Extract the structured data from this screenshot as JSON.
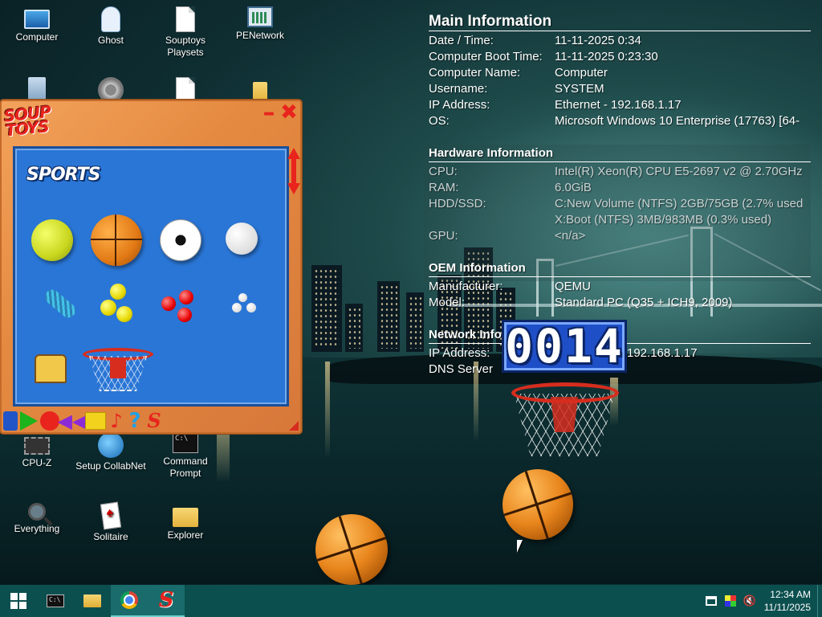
{
  "desktop": {
    "icons": [
      {
        "label": "Computer",
        "icon": "computer-icon"
      },
      {
        "label": "Ghost",
        "icon": "ghost-icon"
      },
      {
        "label": "Souptoys Playsets",
        "icon": "document-icon"
      },
      {
        "label": "PENetwork",
        "icon": "network-icon"
      },
      {
        "label": "",
        "icon": "recycle-bin-icon"
      },
      {
        "label": "",
        "icon": "gear-icon"
      },
      {
        "label": "",
        "icon": "document-icon"
      },
      {
        "label": "",
        "icon": "folder-icon"
      },
      {
        "label": "CPU-Z",
        "icon": "chip-icon"
      },
      {
        "label": "Setup CollabNet",
        "icon": "globe-icon"
      },
      {
        "label": "Command Prompt",
        "icon": "command-prompt-icon"
      },
      {
        "label": "Everything",
        "icon": "magnifier-icon"
      },
      {
        "label": "Solitaire",
        "icon": "cards-icon"
      },
      {
        "label": "Explorer",
        "icon": "folder-icon"
      }
    ]
  },
  "sysinfo": {
    "main": {
      "heading": "Main Information",
      "rows": [
        {
          "k": "Date / Time:",
          "v": "11-11-2025 0:34"
        },
        {
          "k": "Computer Boot Time:",
          "v": "11-11-2025 0:23:30"
        },
        {
          "k": "Computer Name:",
          "v": "Computer"
        },
        {
          "k": "Username:",
          "v": "SYSTEM"
        },
        {
          "k": "IP Address:",
          "v": "Ethernet - 192.168.1.17"
        },
        {
          "k": "OS:",
          "v": "Microsoft Windows 10 Enterprise (17763) [64-"
        }
      ]
    },
    "hardware": {
      "heading": "Hardware Information",
      "rows": [
        {
          "k": "CPU:",
          "v": "Intel(R) Xeon(R) CPU E5-2697 v2 @ 2.70GHz"
        },
        {
          "k": "RAM:",
          "v": "6.0GiB"
        },
        {
          "k": "HDD/SSD:",
          "v": "C:New Volume (NTFS) 2GB/75GB (2.7% used"
        },
        {
          "k": "",
          "v": "X:Boot (NTFS) 3MB/983MB (0.3% used)"
        },
        {
          "k": "GPU:",
          "v": "<n/a>"
        }
      ]
    },
    "oem": {
      "heading": "OEM Information",
      "rows": [
        {
          "k": "Manufacturer:",
          "v": "QEMU"
        },
        {
          "k": "Model:",
          "v": "Standard PC (Q35 + ICH9, 2009)"
        }
      ]
    },
    "network": {
      "heading": "Network Infor",
      "rows": [
        {
          "k": "IP Address:",
          "v": "192.168.1.17"
        },
        {
          "k": "DNS Server",
          "v": ""
        }
      ]
    }
  },
  "souptoys": {
    "logo": "SOUP TOYS",
    "category_title": "SPORTS",
    "toys": [
      "tennis-ball",
      "basketball",
      "soccer-ball",
      "baseball",
      "slinky",
      "yellow-balls",
      "red-balls",
      "white-balls",
      "roller-skate",
      "basketball-hoop"
    ],
    "toolbar": [
      "blue-tool-icon",
      "play-icon",
      "record-icon",
      "rewind-icon",
      "stop-icon",
      "music-note-icon",
      "help-icon",
      "souptoys-s-icon"
    ],
    "glyphs": {
      "min": "–",
      "close": "✖",
      "rewind": "◀◀",
      "note": "♪",
      "help": "?",
      "s": "S"
    }
  },
  "game": {
    "score": "0014"
  },
  "taskbar": {
    "items": [
      "start-button",
      "command-prompt",
      "file-explorer",
      "chrome",
      "souptoys"
    ],
    "cmd_text": "C:\\",
    "souptoys_glyph": "S",
    "clock_time": "12:34 AM",
    "clock_date": "11/11/2025",
    "mute_glyph": "🔇"
  },
  "colors": {
    "taskbar": "#0c4f4f",
    "souptoys_frame": "#e48a40",
    "souptoys_panel": "#2a76d6",
    "scoreboard": "#1f4fc7",
    "accent_red": "#e8241d"
  }
}
